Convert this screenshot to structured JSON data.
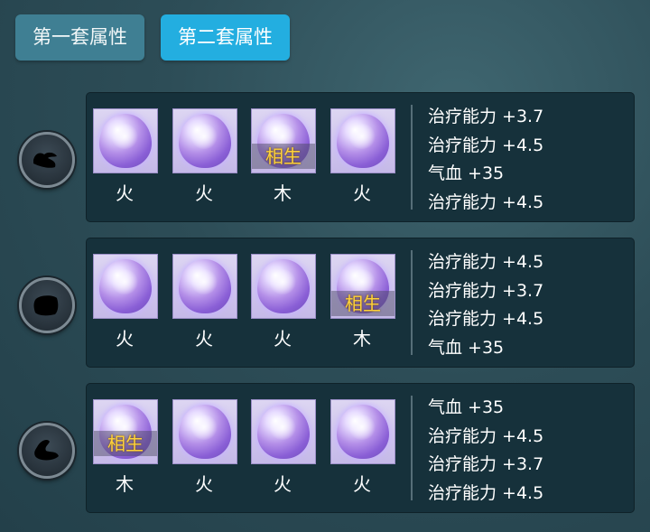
{
  "tabs": [
    {
      "label": "第一套属性",
      "active": false
    },
    {
      "label": "第二套属性",
      "active": true
    }
  ],
  "colors": {
    "tab_active": "#23aee0",
    "tab_inactive": "#3f7f93",
    "xiangsheng": "#ffd23a"
  },
  "rows": [
    {
      "slot_icon": "helmet-icon",
      "gems": [
        {
          "element": "火",
          "tag": ""
        },
        {
          "element": "火",
          "tag": ""
        },
        {
          "element": "木",
          "tag": "相生"
        },
        {
          "element": "火",
          "tag": ""
        }
      ],
      "stats": [
        "治疗能力 +3.7",
        "治疗能力 +4.5",
        "气血 +35",
        "治疗能力 +4.5"
      ]
    },
    {
      "slot_icon": "armor-icon",
      "gems": [
        {
          "element": "火",
          "tag": ""
        },
        {
          "element": "火",
          "tag": ""
        },
        {
          "element": "火",
          "tag": ""
        },
        {
          "element": "木",
          "tag": "相生"
        }
      ],
      "stats": [
        "治疗能力 +4.5",
        "治疗能力 +3.7",
        "治疗能力 +4.5",
        "气血 +35"
      ]
    },
    {
      "slot_icon": "boots-icon",
      "gems": [
        {
          "element": "木",
          "tag": "相生"
        },
        {
          "element": "火",
          "tag": ""
        },
        {
          "element": "火",
          "tag": ""
        },
        {
          "element": "火",
          "tag": ""
        }
      ],
      "stats": [
        "气血 +35",
        "治疗能力 +4.5",
        "治疗能力 +3.7",
        "治疗能力 +4.5"
      ]
    }
  ]
}
